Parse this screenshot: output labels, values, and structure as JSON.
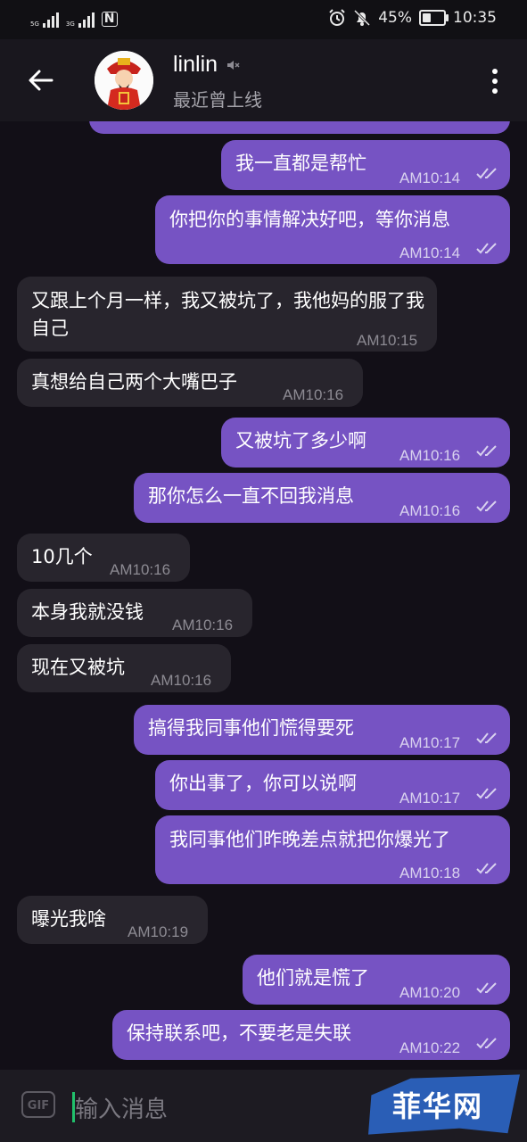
{
  "status": {
    "signal1": "5G",
    "signal2": "3G",
    "battery_pct": "45%",
    "battery_level": 0.45,
    "time": "10:35"
  },
  "header": {
    "contact_name": "linlin",
    "subtitle": "最近曾上线"
  },
  "messages": [
    {
      "dir": "out",
      "text": "我一直都是帮忙",
      "time": "AM10:14"
    },
    {
      "dir": "out",
      "text": "你把你的事情解决好吧，等你消息",
      "time": "AM10:14"
    },
    {
      "dir": "in",
      "text": "又跟上个月一样，我又被坑了，我他妈的服了我自己",
      "time": "AM10:15"
    },
    {
      "dir": "in",
      "text": "真想给自己两个大嘴巴子",
      "time": "AM10:16"
    },
    {
      "dir": "out",
      "text": "又被坑了多少啊",
      "time": "AM10:16"
    },
    {
      "dir": "out",
      "text": "那你怎么一直不回我消息",
      "time": "AM10:16"
    },
    {
      "dir": "in",
      "text": "10几个",
      "time": "AM10:16"
    },
    {
      "dir": "in",
      "text": "本身我就没钱",
      "time": "AM10:16"
    },
    {
      "dir": "in",
      "text": "现在又被坑",
      "time": "AM10:16"
    },
    {
      "dir": "out",
      "text": "搞得我同事他们慌得要死",
      "time": "AM10:17"
    },
    {
      "dir": "out",
      "text": "你出事了，你可以说啊",
      "time": "AM10:17"
    },
    {
      "dir": "out",
      "text": "我同事他们昨晚差点就把你爆光了",
      "time": "AM10:18"
    },
    {
      "dir": "in",
      "text": "曝光我啥",
      "time": "AM10:19"
    },
    {
      "dir": "out",
      "text": "他们就是慌了",
      "time": "AM10:20"
    },
    {
      "dir": "out",
      "text": "保持联系吧，不要老是失联",
      "time": "AM10:22"
    }
  ],
  "composer": {
    "gif_label": "GIF",
    "placeholder": "输入消息"
  },
  "watermark": {
    "text": "菲华网"
  },
  "colors": {
    "outgoing_bubble": "#7653c3",
    "incoming_bubble": "#28252d",
    "background": "#120f17"
  }
}
